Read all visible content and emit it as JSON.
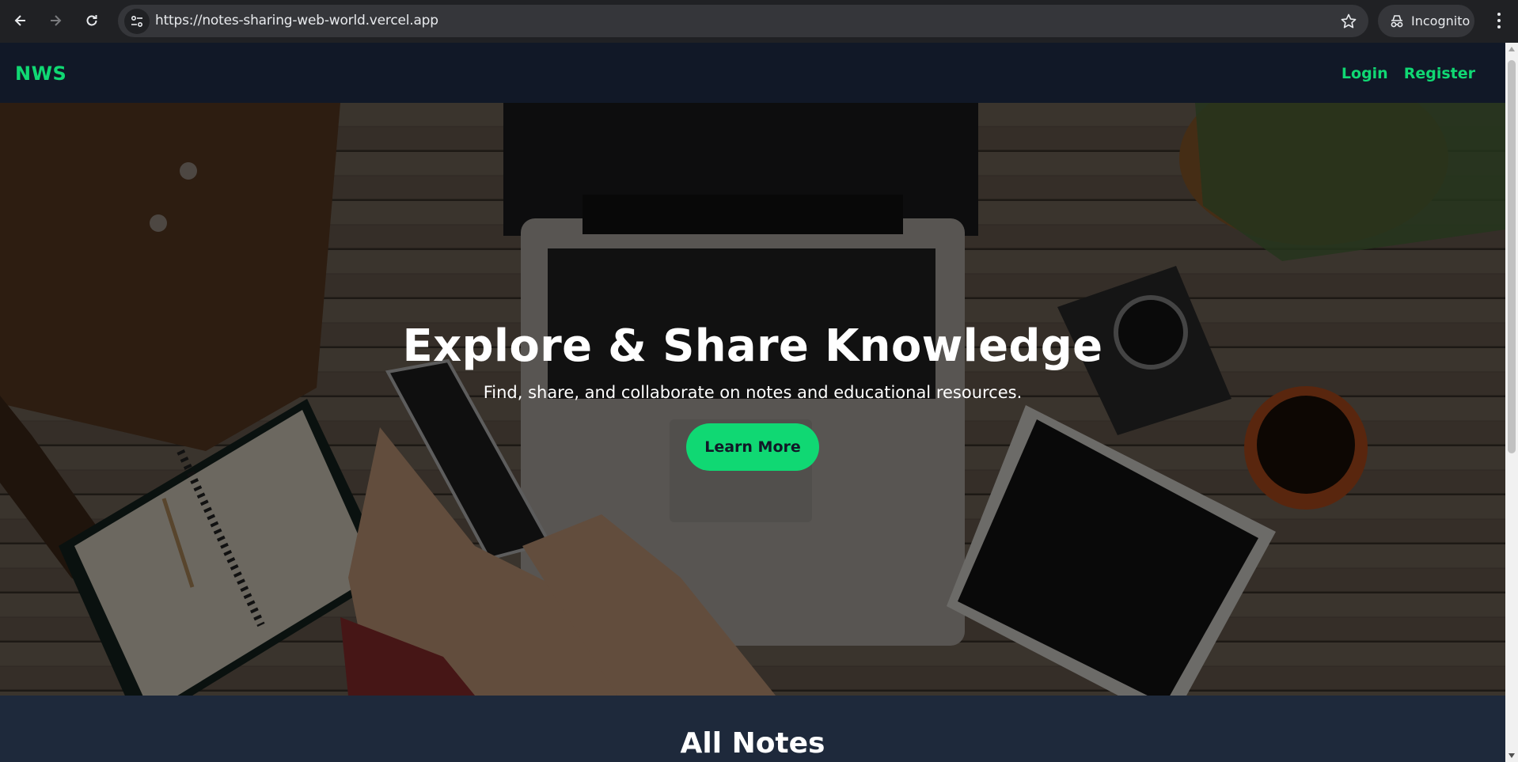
{
  "browser": {
    "url": "https://notes-sharing-web-world.vercel.app",
    "incognito_label": "Incognito"
  },
  "site": {
    "brand": "NWS",
    "nav": [
      {
        "label": "Login"
      },
      {
        "label": "Register"
      }
    ]
  },
  "hero": {
    "title": "Explore & Share Knowledge",
    "subtitle": "Find, share, and collaborate on notes and educational resources.",
    "cta_label": "Learn More"
  },
  "notes_section": {
    "title": "All Notes"
  },
  "colors": {
    "accent": "#10d873",
    "nav_bg": "#111827",
    "section_bg": "#1e293b"
  }
}
